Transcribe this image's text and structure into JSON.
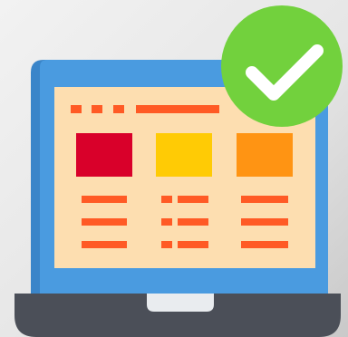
{
  "illustration": {
    "subject": "laptop-with-checkmark",
    "colors": {
      "background_light": "#ececec",
      "background_dark": "#c7c7c7",
      "laptop_frame": "#4a9be0",
      "laptop_frame_shadow": "#3a85c9",
      "screen": "#fddeb0",
      "base_dark": "#4b4f58",
      "base_notch": "#e9ecef",
      "accent_orange": "#ff5a25",
      "tile_red": "#d9002a",
      "tile_yellow": "#ffcb05",
      "tile_orange": "#ff9413",
      "check_badge": "#72d13d",
      "check_mark": "#ffffff"
    },
    "icons": [
      "laptop-icon",
      "checkmark-badge-icon"
    ]
  }
}
